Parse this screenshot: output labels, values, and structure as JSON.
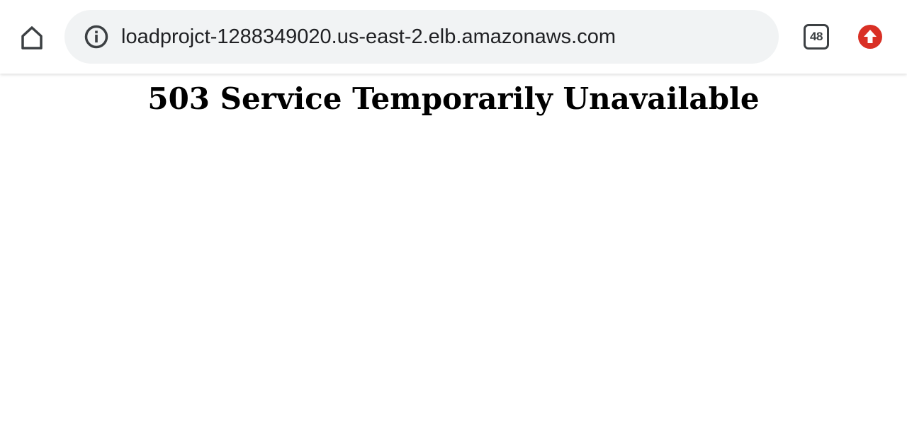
{
  "browser": {
    "url": "loadprojct-1288349020.us-east-2.elb.amazonaws.com",
    "tab_count": "48",
    "icons": {
      "home": "home-icon",
      "site_info": "info-icon",
      "tab_switcher": "tab-switcher-icon",
      "update": "update-available-icon"
    },
    "colors": {
      "omnibox_background": "#f1f3f4",
      "update_badge": "#d93025"
    }
  },
  "page": {
    "heading": "503 Service Temporarily Unavailable"
  }
}
